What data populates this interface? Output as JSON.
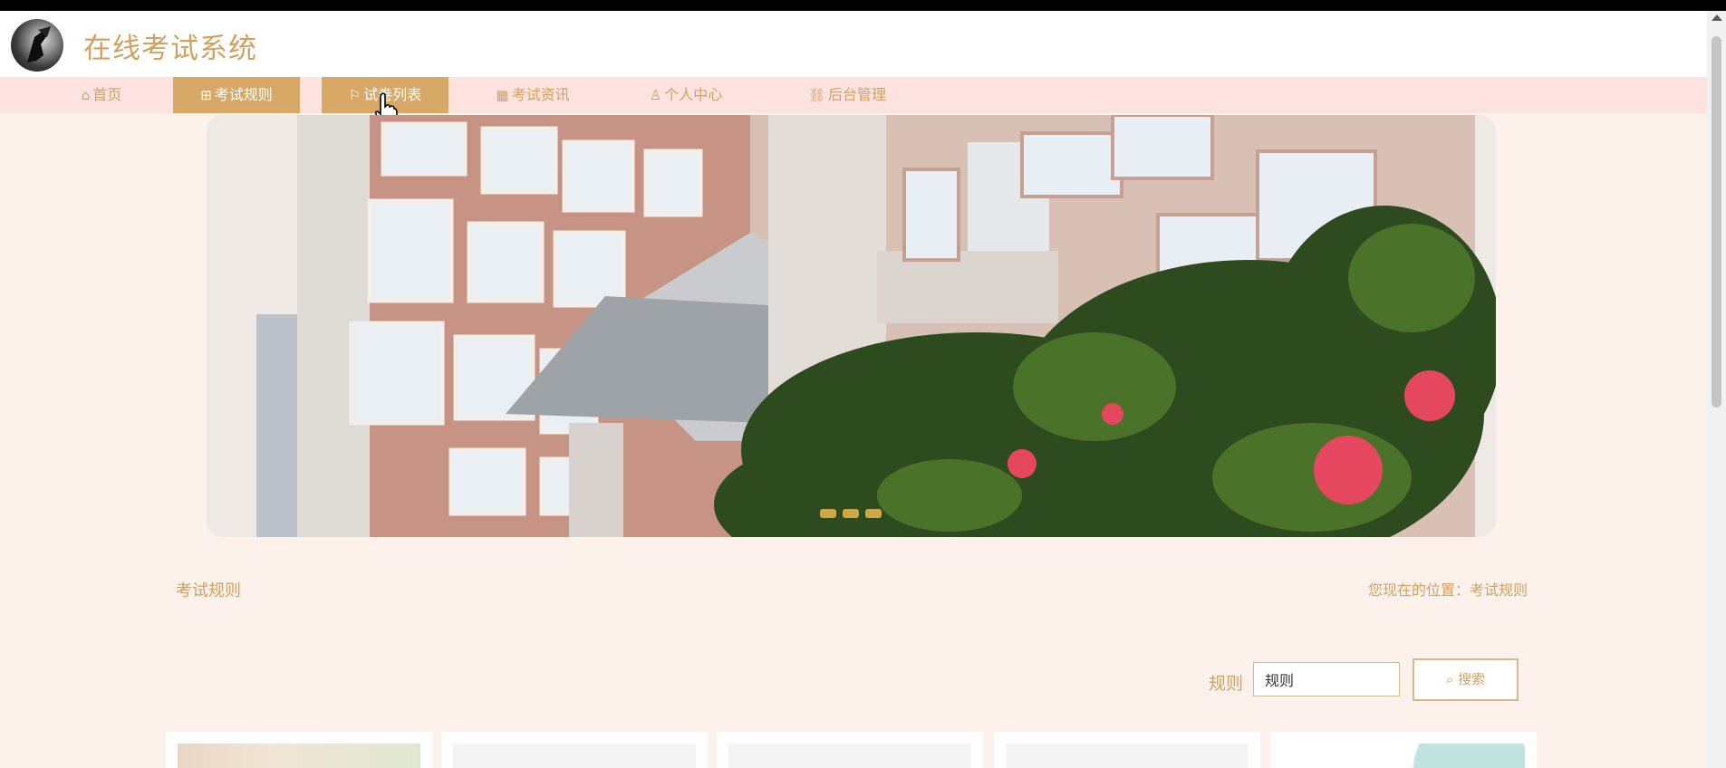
{
  "app": {
    "title": "在线考试系统"
  },
  "nav": {
    "items": [
      {
        "label": "首页",
        "icon": "home-icon"
      },
      {
        "label": "考试规则",
        "icon": "gift-icon"
      },
      {
        "label": "试卷列表",
        "icon": "flag-icon"
      },
      {
        "label": "考试资讯",
        "icon": "grid-icon"
      },
      {
        "label": "个人中心",
        "icon": "user-icon"
      },
      {
        "label": "后台管理",
        "icon": "link-icon"
      }
    ],
    "active_index": 2,
    "highlighted_index": 1
  },
  "banner": {
    "dots": 3
  },
  "page": {
    "section_title": "考试规则",
    "breadcrumb": "您现在的位置：考试规则"
  },
  "search": {
    "label": "规则",
    "value": "规则",
    "button_label": "搜索"
  },
  "colors": {
    "accent": "#d7a866",
    "nav_bg": "#fde3e0",
    "page_bg": "#fdf1ec",
    "text_accent": "#d0a15f"
  }
}
